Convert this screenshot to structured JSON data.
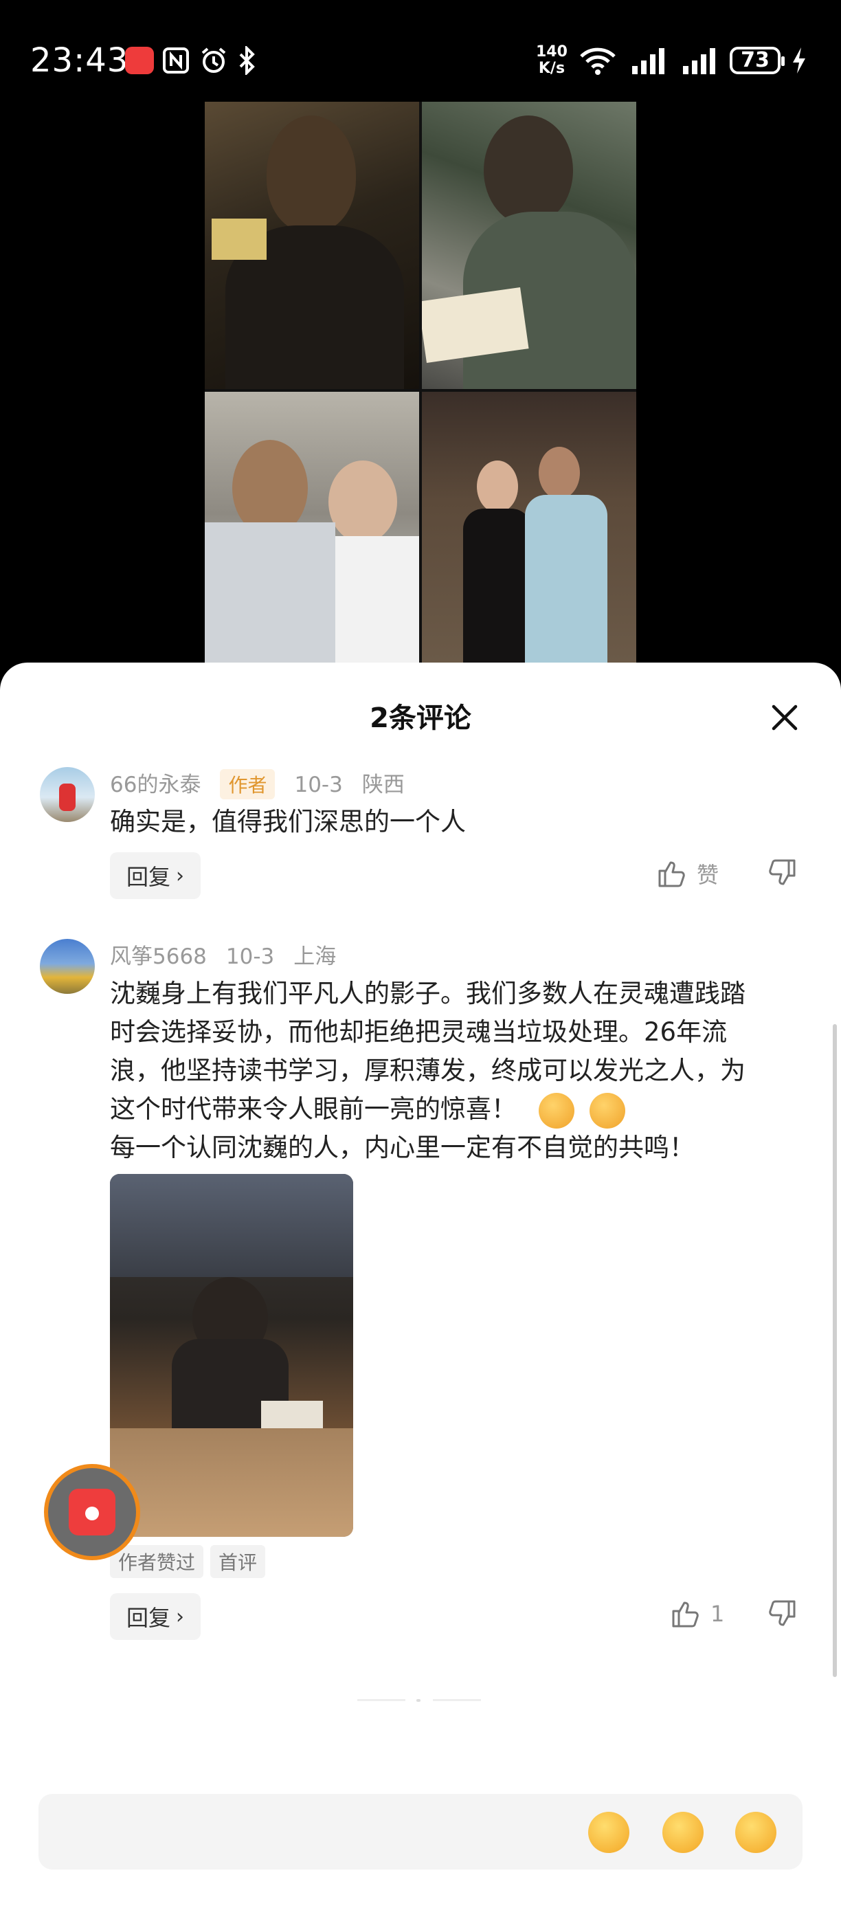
{
  "status_bar": {
    "time": "23:43",
    "network_speed": "140",
    "network_unit": "K/s",
    "battery": "73",
    "icons": [
      "huawei-app-icon",
      "nfc-icon",
      "alarm-icon",
      "bluetooth-icon",
      "wifi-icon",
      "signal-icon",
      "signal-icon",
      "charging-icon"
    ]
  },
  "sheet": {
    "title": "2条评论"
  },
  "comments": [
    {
      "username": "66的永泰",
      "author_tag": "作者",
      "date": "10-3",
      "location": "陕西",
      "text": "确实是，值得我们深思的一个人",
      "reply_label": "回复",
      "like_label": "赞"
    },
    {
      "username": "风筝5668",
      "date": "10-3",
      "location": "上海",
      "text_lines": [
        "沈巍身上有我们平凡人的影子。我们多数人在灵魂遭践踏",
        "时会选择妥协，而他却拒绝把灵魂当垃圾处理。26年流",
        "浪，他坚持读书学习，厚积薄发，终成可以发光之人，为",
        "这个时代带来令人眼前一亮的惊喜！",
        "每一个认同沈巍的人，内心里一定有不自觉的共鸣！"
      ],
      "badges": [
        "作者赞过",
        "首评"
      ],
      "reply_label": "回复",
      "like_count": "1"
    }
  ]
}
